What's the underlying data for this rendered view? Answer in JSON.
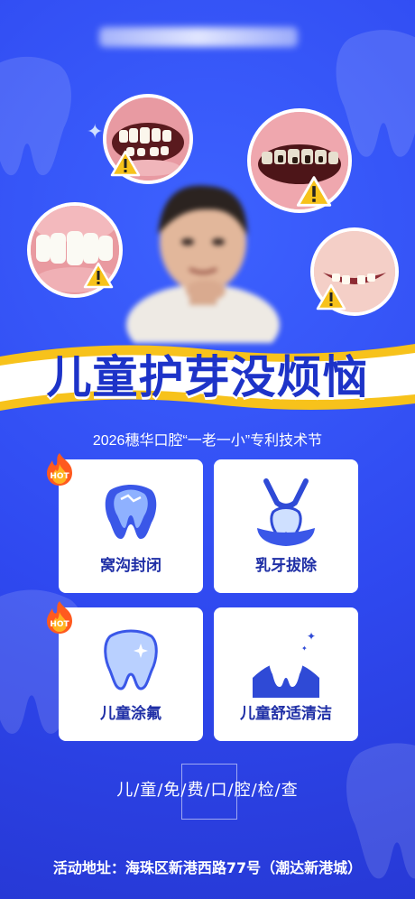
{
  "headline": "儿童护芽没烦恼",
  "subtitle": "2026穗华口腔“一老一小”专利技术节",
  "hot_badge": "HOT",
  "services": [
    {
      "label": "窝沟封闭",
      "icon": "tooth-sealant-icon",
      "hot": true
    },
    {
      "label": "乳牙拔除",
      "icon": "tooth-extraction-icon",
      "hot": false
    },
    {
      "label": "儿童涂氟",
      "icon": "shiny-tooth-icon",
      "hot": true
    },
    {
      "label": "儿童舒适清洁",
      "icon": "clean-tooth-icon",
      "hot": false
    }
  ],
  "free_check": "儿/童/免/费/口/腔/检/查",
  "address": "活动地址：海珠区新港西路77号（潮达新港城）",
  "colors": {
    "background": "#2f49f0",
    "banner": "#f7c21b",
    "card_text": "#1f2fa6",
    "hot_flame": "#ff5a1f"
  }
}
